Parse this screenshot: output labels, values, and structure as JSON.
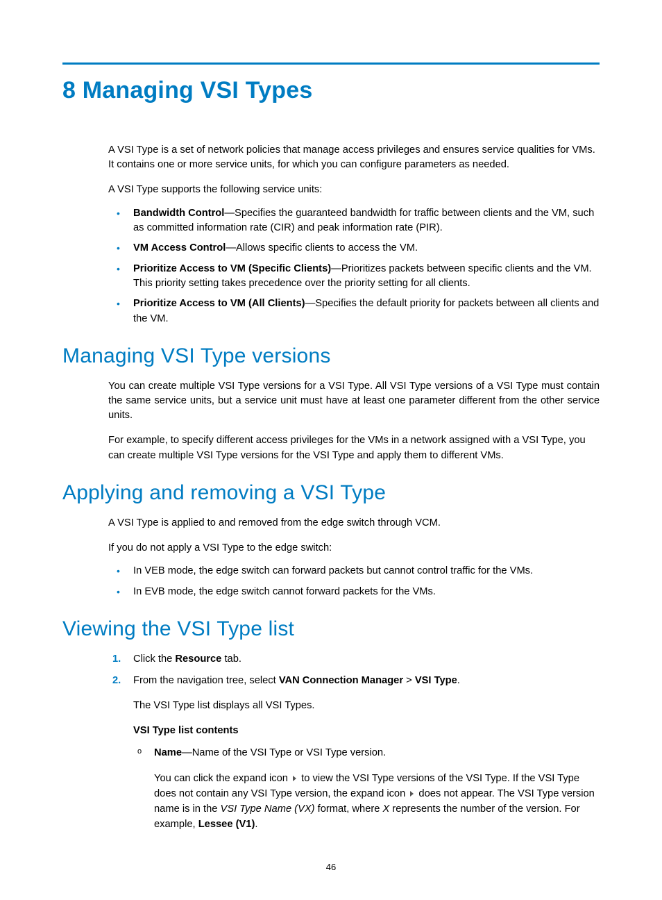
{
  "chapter_title": "8 Managing VSI Types",
  "intro_p1": "A VSI Type is a set of network policies that manage access privileges and ensures service qualities for VMs. It contains one or more service units, for which you can configure parameters as needed.",
  "intro_p2": "A VSI Type supports the following service units:",
  "service_units": [
    {
      "term": "Bandwidth Control",
      "desc": "—Specifies the guaranteed bandwidth for traffic between clients and the VM, such as committed information rate (CIR) and peak information rate (PIR)."
    },
    {
      "term": "VM Access Control",
      "desc": "—Allows specific clients to access the VM."
    },
    {
      "term": "Prioritize Access to VM (Specific Clients)",
      "desc": "—Prioritizes packets between specific clients and the VM. This priority setting takes precedence over the priority setting for all clients."
    },
    {
      "term": "Prioritize Access to VM (All Clients)",
      "desc": "—Specifies the default priority for packets between all clients and the VM."
    }
  ],
  "section_versions": {
    "title": "Managing VSI Type versions",
    "p1": "You can create multiple VSI Type versions for a VSI Type. All VSI Type versions of a VSI Type must contain the same service units, but a service unit must have at least one parameter different from the other service units.",
    "p2": "For example, to specify different access privileges for the VMs in a network assigned with a VSI Type, you can create multiple VSI Type versions for the VSI Type and apply them to different VMs."
  },
  "section_apply": {
    "title": "Applying and removing a VSI Type",
    "p1": "A VSI Type is applied to and removed from the edge switch through VCM.",
    "p2": "If you do not apply a VSI Type to the edge switch:",
    "bullets": [
      "In VEB mode, the edge switch can forward packets but cannot control traffic for the VMs.",
      "In EVB mode, the edge switch cannot forward packets for the VMs."
    ]
  },
  "section_view": {
    "title": "Viewing the VSI Type list",
    "step1_a": "Click the ",
    "step1_b": "Resource",
    "step1_c": " tab.",
    "step2_a": "From the navigation tree, select ",
    "step2_b": "VAN Connection Manager",
    "step2_c": " > ",
    "step2_d": "VSI Type",
    "step2_e": ".",
    "sub1": "The VSI Type list displays all VSI Types.",
    "sub2": "VSI Type list contents",
    "circle_term": "Name",
    "circle_desc": "—Name of the VSI Type or VSI Type version.",
    "circle_sub_a": "You can click the expand icon ",
    "circle_sub_b": " to view the VSI Type versions of the VSI Type. If the VSI Type does not contain any VSI Type version, the expand icon ",
    "circle_sub_c": " does not appear. The VSI Type version name is in the ",
    "circle_sub_d": "VSI Type Name (VX)",
    "circle_sub_e": " format, where ",
    "circle_sub_f": "X",
    "circle_sub_g": " represents the number of the version. For example, ",
    "circle_sub_h": "Lessee (V1)",
    "circle_sub_i": "."
  },
  "page_number": "46"
}
